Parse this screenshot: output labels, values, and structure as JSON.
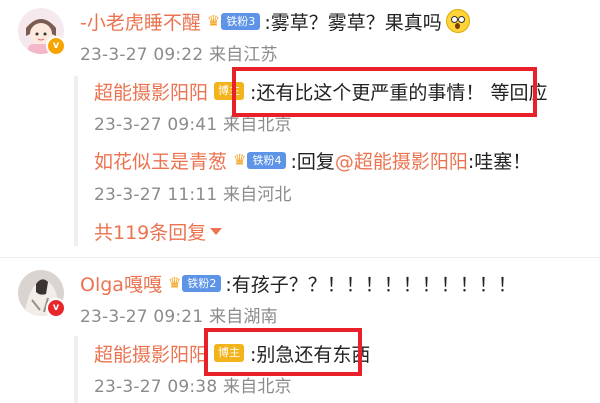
{
  "comments": [
    {
      "username": "-小老虎睡不醒",
      "fan_badge": "铁粉3",
      "text": ":雾草？雾草？果真吗",
      "meta": "23-3-27 09:22 来自江苏",
      "replies": [
        {
          "username": "超能摄影阳阳",
          "tag": "博主",
          "text": ":还有比这个更严重的事情！ 等回应",
          "meta": "23-3-27 09:41 来自北京"
        },
        {
          "username": "如花似玉是青葱",
          "fan_badge": "铁粉4",
          "prefix": ":回复",
          "mention": "@超能摄影阳阳",
          "text": ":哇塞！",
          "meta": "23-3-27 11:11 来自河北"
        }
      ],
      "more_replies": "共119条回复"
    },
    {
      "username": "Olga嘎嘎",
      "fan_badge": "铁粉2",
      "text": ":有孩子？？！！！！！！！！！！",
      "meta": "23-3-27 09:21 来自湖南",
      "replies": [
        {
          "username": "超能摄影阳阳",
          "tag": "博主",
          "text": ":别急还有东西",
          "meta": "23-3-27 09:38 来自北京"
        }
      ]
    }
  ],
  "icons": {
    "crown": "crown-icon",
    "verified": "verified-badge-icon",
    "emoji": "surprised-emoji-icon",
    "caret": "caret-down-icon"
  },
  "colors": {
    "username": "#eb7350",
    "meta": "#8b8b8b",
    "highlight_box": "#e8202a",
    "fan_pill": "#5d94e8",
    "boss_tag": "#f2b31c"
  }
}
